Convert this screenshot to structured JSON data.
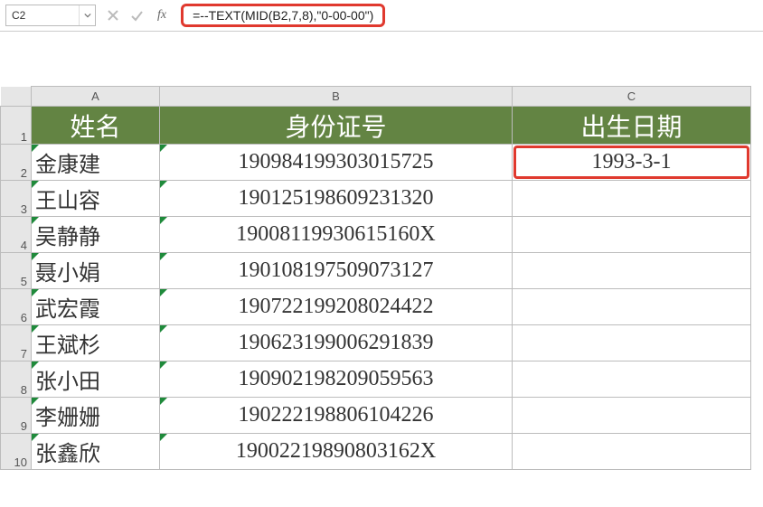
{
  "name_box": {
    "value": "C2"
  },
  "formula_bar": {
    "formula": "=--TEXT(MID(B2,7,8),\"0-00-00\")"
  },
  "columns": {
    "A": "A",
    "B": "B",
    "C": "C"
  },
  "row_labels": [
    "1",
    "2",
    "3",
    "4",
    "5",
    "6",
    "7",
    "8",
    "9",
    "10"
  ],
  "headers": {
    "A": "姓名",
    "B": "身份证号",
    "C": "出生日期"
  },
  "rows": [
    {
      "name": "金康建",
      "id": "190984199303015725",
      "dob": "1993-3-1"
    },
    {
      "name": "王山容",
      "id": "190125198609231320",
      "dob": ""
    },
    {
      "name": "吴静静",
      "id": "19008119930615160X",
      "dob": ""
    },
    {
      "name": "聂小娟",
      "id": "190108197509073127",
      "dob": ""
    },
    {
      "name": "武宏霞",
      "id": "190722199208024422",
      "dob": ""
    },
    {
      "name": "王斌杉",
      "id": "190623199006291839",
      "dob": ""
    },
    {
      "name": "张小田",
      "id": "190902198209059563",
      "dob": ""
    },
    {
      "name": "李姗姗",
      "id": "190222198806104226",
      "dob": ""
    },
    {
      "name": "张鑫欣",
      "id": "19002219890803162X",
      "dob": ""
    }
  ],
  "selected_cell": "C2"
}
